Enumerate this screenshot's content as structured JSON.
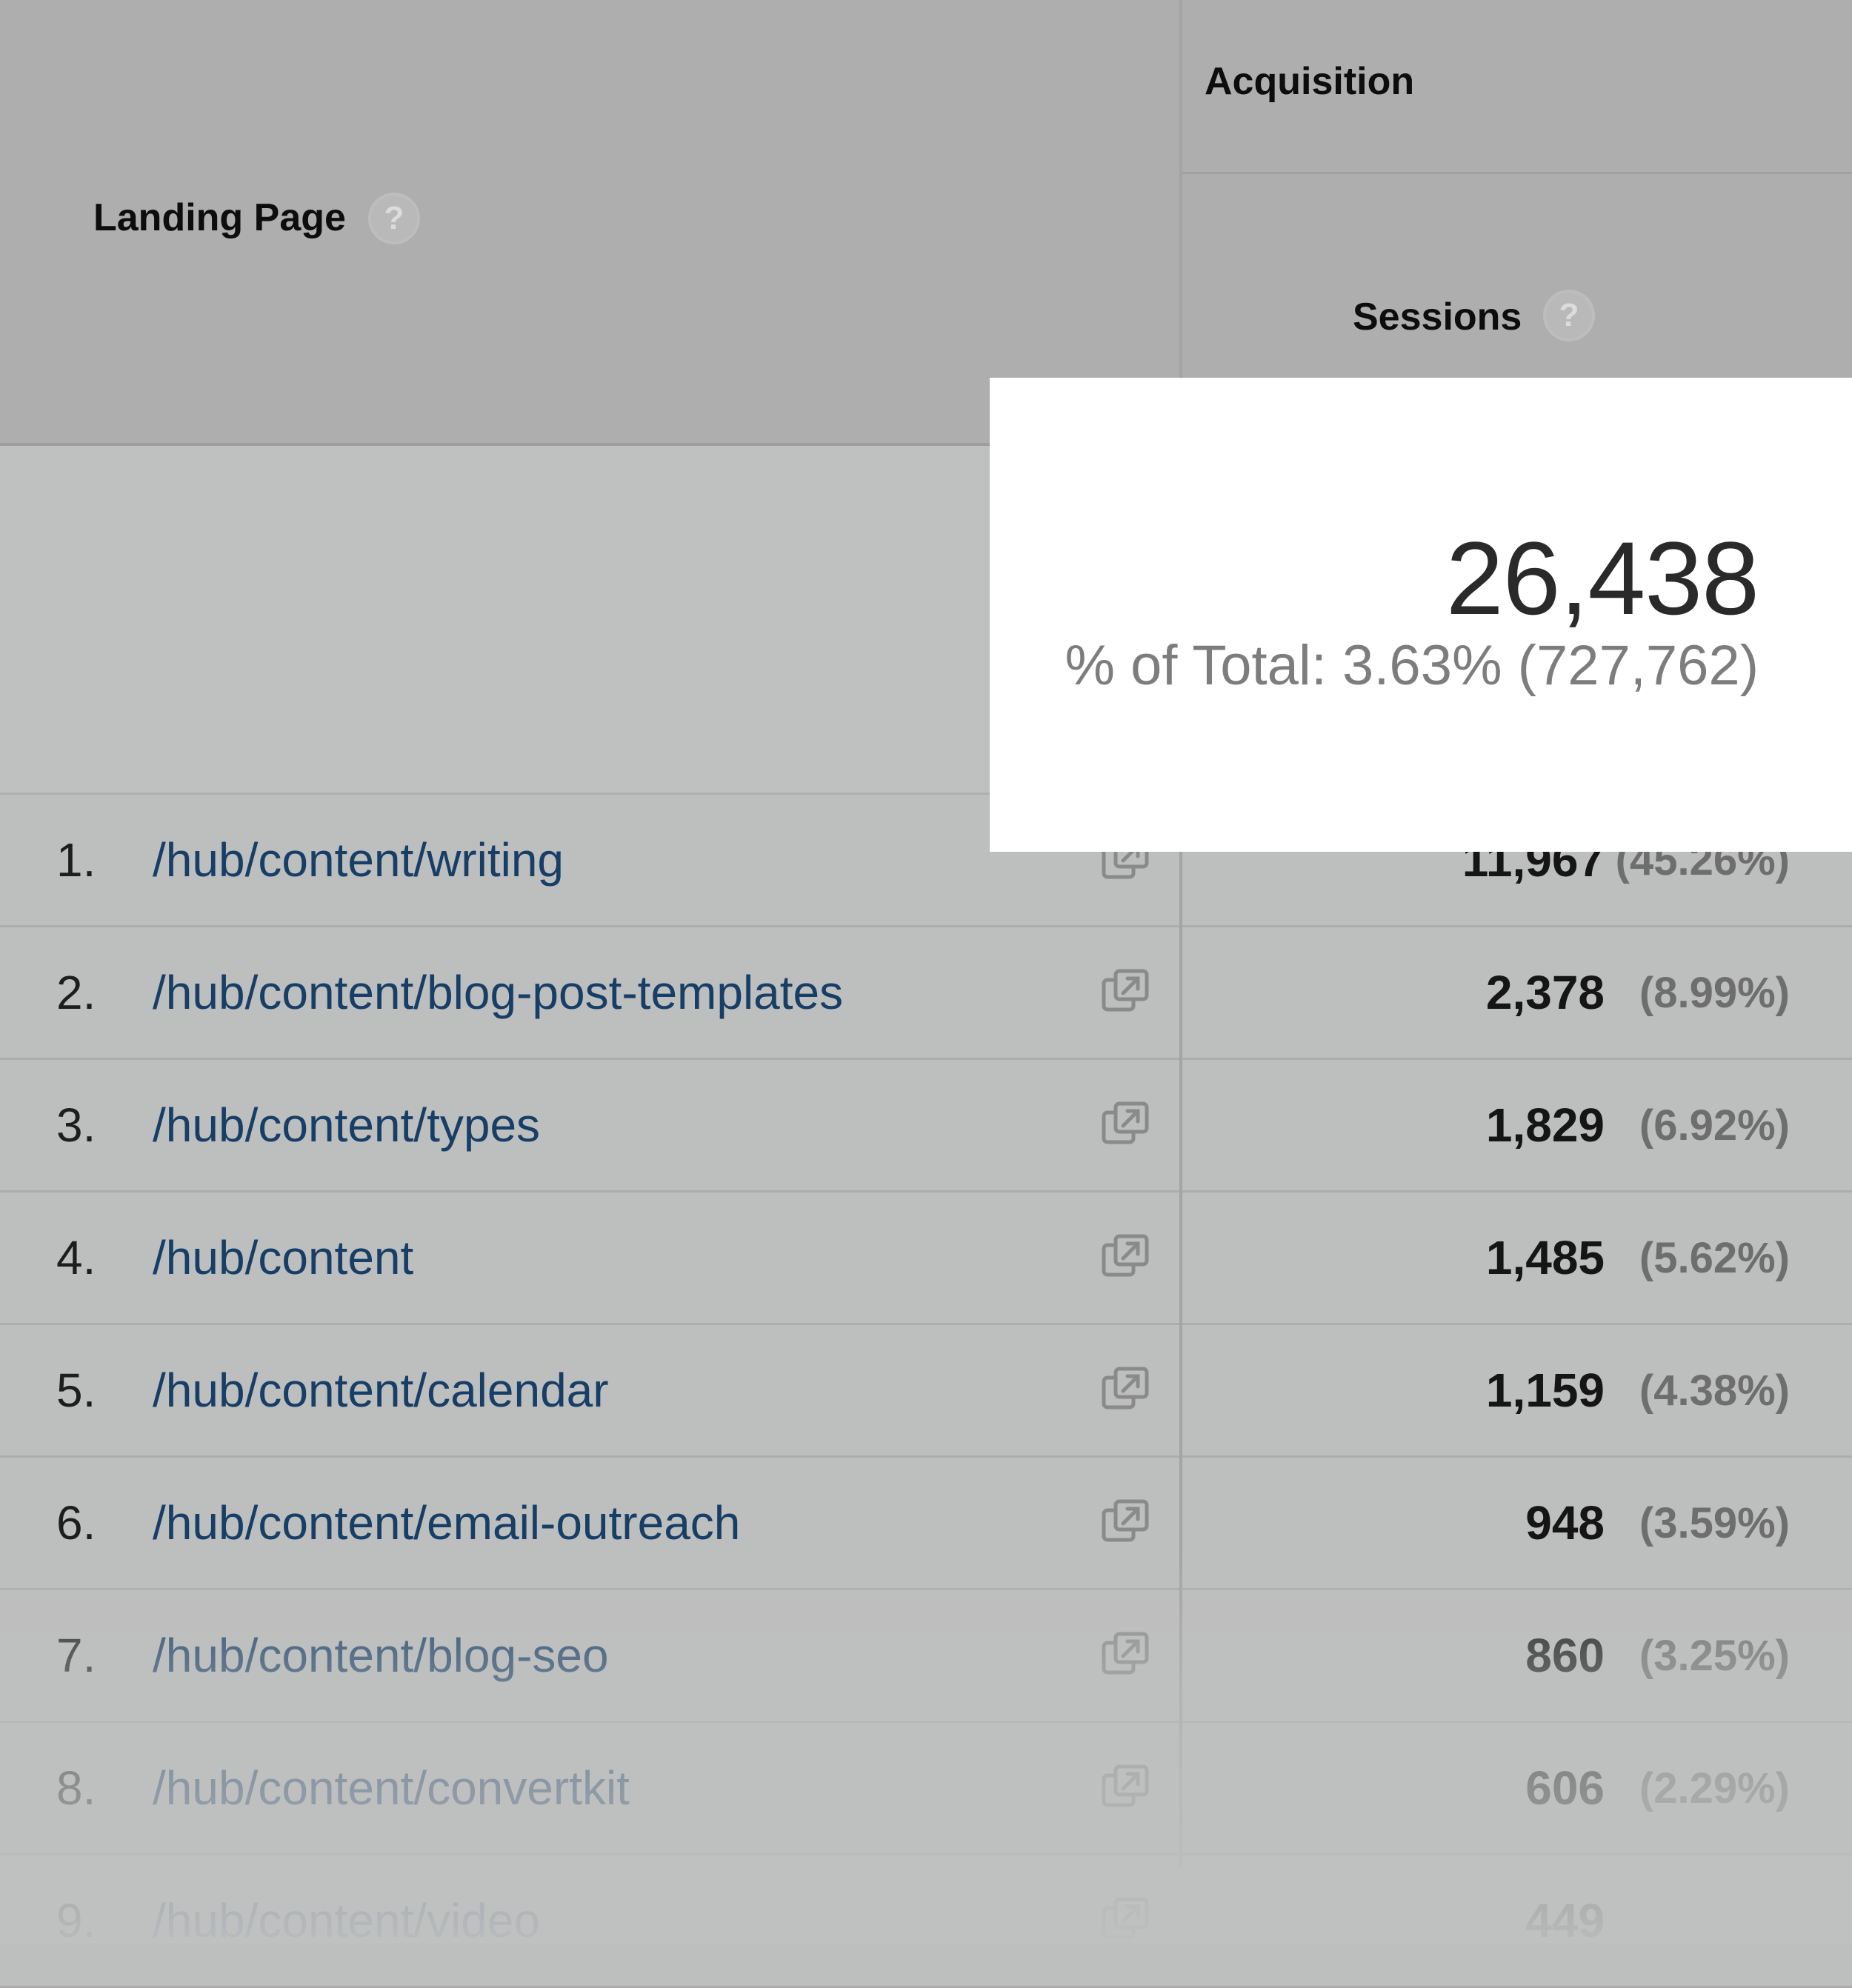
{
  "header": {
    "group_label": "Acquisition",
    "dimension_label": "Landing Page",
    "metric_label": "Sessions",
    "help_glyph": "?"
  },
  "totals": {
    "value": "26,438",
    "summary": "% of Total: 3.63% (727,762)"
  },
  "rows": [
    {
      "num": "1.",
      "path": "/hub/content/writing",
      "sessions": "11,967",
      "pct": "(45.26%)"
    },
    {
      "num": "2.",
      "path": "/hub/content/blog-post-templates",
      "sessions": "2,378",
      "pct": "(8.99%)"
    },
    {
      "num": "3.",
      "path": "/hub/content/types",
      "sessions": "1,829",
      "pct": "(6.92%)"
    },
    {
      "num": "4.",
      "path": "/hub/content",
      "sessions": "1,485",
      "pct": "(5.62%)"
    },
    {
      "num": "5.",
      "path": "/hub/content/calendar",
      "sessions": "1,159",
      "pct": "(4.38%)"
    },
    {
      "num": "6.",
      "path": "/hub/content/email-outreach",
      "sessions": "948",
      "pct": "(3.59%)"
    },
    {
      "num": "7.",
      "path": "/hub/content/blog-seo",
      "sessions": "860",
      "pct": "(3.25%)"
    },
    {
      "num": "8.",
      "path": "/hub/content/convertkit",
      "sessions": "606",
      "pct": "(2.29%)"
    },
    {
      "num": "9.",
      "path": "/hub/content/video",
      "sessions": "449",
      "pct": ""
    }
  ],
  "icons": {
    "row_action": "open-in-new-window-icon",
    "help": "help-icon"
  }
}
